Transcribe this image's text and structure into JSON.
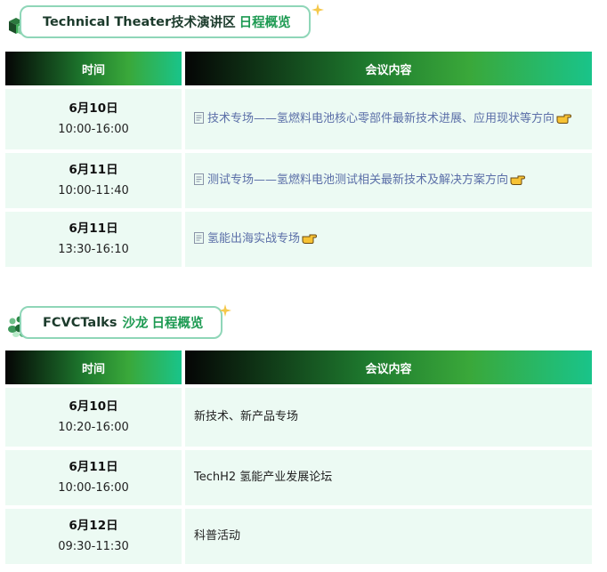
{
  "sections": [
    {
      "title_en": "Technical Theater",
      "title_cn": "技术演讲区",
      "title_green": "日程概览",
      "headers": [
        "时间",
        "会议内容"
      ],
      "rows": [
        {
          "date": "6月10日",
          "hours": "10:00-16:00",
          "text": "技术专场——氢燃料电池核心零部件最新技术进展、应用现状等方向"
        },
        {
          "date": "6月11日",
          "hours": "10:00-11:40",
          "text": "测试专场——氢燃料电池测试相关最新技术及解决方案方向"
        },
        {
          "date": "6月11日",
          "hours": "13:30-16:10",
          "text": "氢能出海实战专场"
        }
      ]
    },
    {
      "title_en": "FCVCTalks",
      "title_cn": "沙龙",
      "title_green": "日程概览",
      "headers": [
        "时间",
        "会议内容"
      ],
      "rows": [
        {
          "date": "6月10日",
          "hours": "10:20-16:00",
          "text": "新技术、新产品专场"
        },
        {
          "date": "6月11日",
          "hours": "10:00-16:00",
          "text": "TechH2 氢能产业发展论坛"
        },
        {
          "date": "6月12日",
          "hours": "09:30-11:30",
          "text": "科普活动"
        }
      ]
    }
  ],
  "colors": {
    "accent_green": "#1d9a52",
    "row_bg": "#ecfaf3",
    "link": "#5b6fa8",
    "border": "#8fd6b8"
  },
  "icons": {
    "row_link": "doc-icon",
    "row_pointer": "pointing-hand-icon",
    "section1": "isometric-blocks-icon",
    "section2": "people-group-icon",
    "title": "sparkle-icon"
  }
}
